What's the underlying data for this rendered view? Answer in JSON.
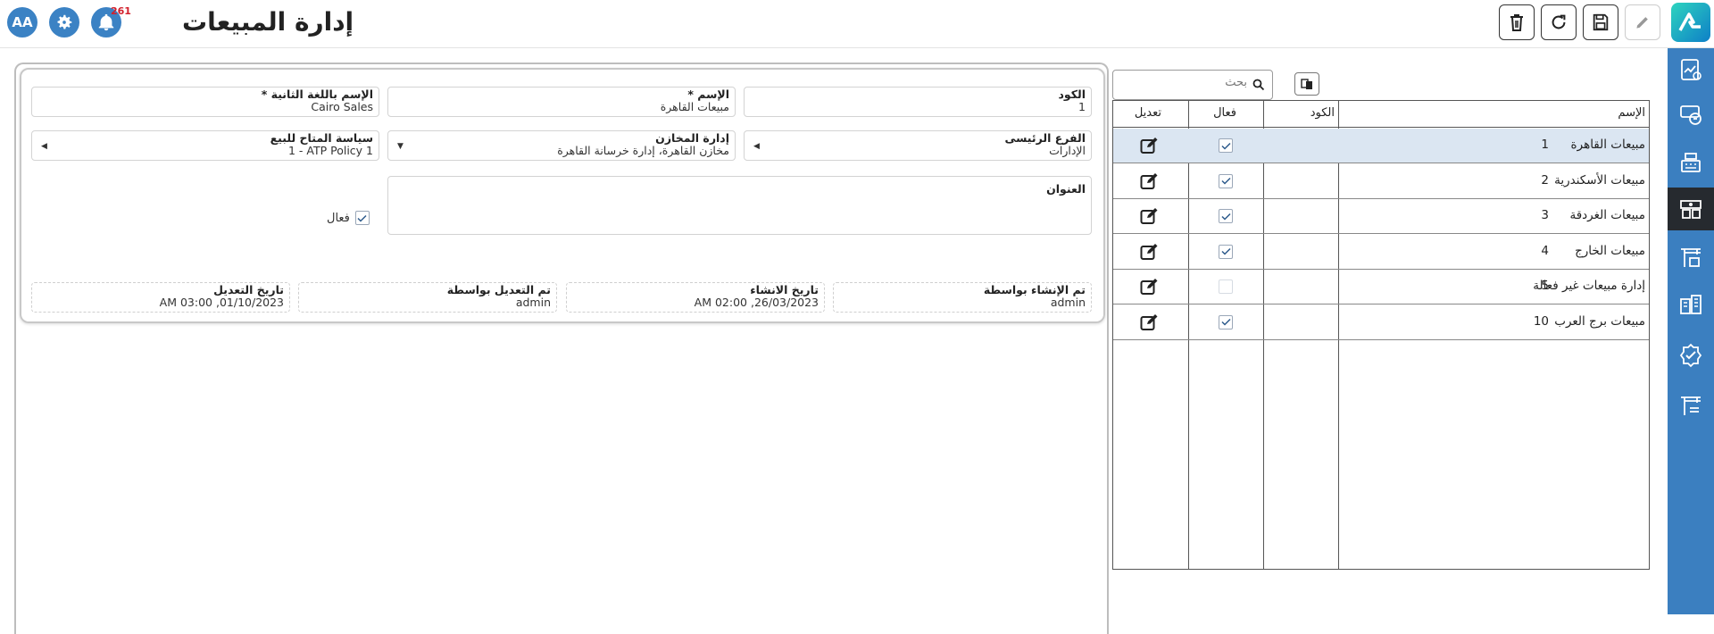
{
  "header": {
    "title": "إدارة المبيعات",
    "user_initials": "AA",
    "notification_count": "261"
  },
  "form": {
    "code": {
      "label": "الكود",
      "value": "1"
    },
    "name": {
      "label": "الإسم *",
      "value": "مبيعات القاهرة"
    },
    "second_name": {
      "label": "الإسم باللغة الثانية *",
      "value": "Cairo Sales"
    },
    "main_branch": {
      "label": "الفرع الرئيسى",
      "value": "الإدارات"
    },
    "warehouses": {
      "label": "إدارة المخازن",
      "value": "مخازن القاهرة، إدارة خرسانة القاهرة"
    },
    "atp_policy": {
      "label": "سياسة المتاح للبيع",
      "value": "1 - ATP Policy 1"
    },
    "address": {
      "label": "العنوان",
      "value": ""
    },
    "active_label": "فعال",
    "created_by": {
      "label": "تم الإنشاء بواسطة",
      "value": "admin"
    },
    "created_date": {
      "label": "تاريخ الانشاء",
      "value": "26/03/2023, 02:00 AM"
    },
    "modified_by": {
      "label": "تم التعديل بواسطة",
      "value": "admin"
    },
    "modified_date": {
      "label": "تاريخ التعديل",
      "value": "01/10/2023, 03:00 AM"
    }
  },
  "list": {
    "search_placeholder": "بحث",
    "columns": {
      "name": "الإسم",
      "code": "الكود",
      "active": "فعال",
      "edit": "تعديل"
    },
    "rows": [
      {
        "name": "مبيعات القاهرة",
        "code": "1",
        "active": true
      },
      {
        "name": "مبيعات الأسكندرية",
        "code": "2",
        "active": true
      },
      {
        "name": "مبيعات الغردقة",
        "code": "3",
        "active": true
      },
      {
        "name": "مبيعات الخارج",
        "code": "4",
        "active": true
      },
      {
        "name": "إدارة مبيعات غير فعالة",
        "code": "5",
        "active": false
      },
      {
        "name": "مبيعات برج العرب",
        "code": "10",
        "active": true
      }
    ]
  },
  "colors": {
    "accent": "#3b82c4",
    "sidebar": "#3b7fc0",
    "badge": "#d21f2b",
    "selected_row": "#dbe6f2"
  }
}
